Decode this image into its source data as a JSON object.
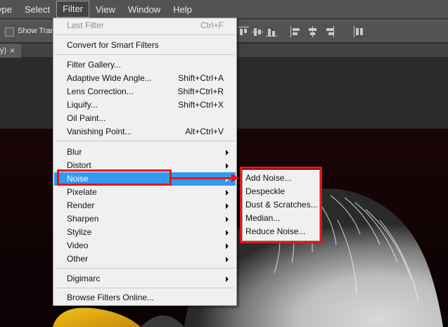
{
  "menubar": {
    "items": [
      {
        "label": "ype"
      },
      {
        "label": "Select"
      },
      {
        "label": "Filter"
      },
      {
        "label": "View"
      },
      {
        "label": "Window"
      },
      {
        "label": "Help"
      }
    ]
  },
  "options": {
    "show_label": "Show Trans",
    "icons": [
      "align-top-edges-icon",
      "align-vertical-centers-icon",
      "align-bottom-edges-icon",
      "align-left-edges-icon",
      "align-horizontal-centers-icon",
      "align-right-edges-icon",
      "distribute-icon"
    ]
  },
  "document_tab": {
    "label": "y)",
    "close": "×"
  },
  "filter_menu": {
    "last_filter": {
      "label": "Last Filter",
      "shortcut": "Ctrl+F"
    },
    "convert": {
      "label": "Convert for Smart Filters"
    },
    "filter_gallery": {
      "label": "Filter Gallery..."
    },
    "adaptive": {
      "label": "Adaptive Wide Angle...",
      "shortcut": "Shift+Ctrl+A"
    },
    "lens": {
      "label": "Lens Correction...",
      "shortcut": "Shift+Ctrl+R"
    },
    "liquify": {
      "label": "Liquify...",
      "shortcut": "Shift+Ctrl+X"
    },
    "oil": {
      "label": "Oil Paint..."
    },
    "vanishing": {
      "label": "Vanishing Point...",
      "shortcut": "Alt+Ctrl+V"
    },
    "blur": {
      "label": "Blur"
    },
    "distort": {
      "label": "Distort"
    },
    "noise": {
      "label": "Noise"
    },
    "pixelate": {
      "label": "Pixelate"
    },
    "render": {
      "label": "Render"
    },
    "sharpen": {
      "label": "Sharpen"
    },
    "stylize": {
      "label": "Stylize"
    },
    "video": {
      "label": "Video"
    },
    "other": {
      "label": "Other"
    },
    "digimarc": {
      "label": "Digimarc"
    },
    "browse": {
      "label": "Browse Filters Online..."
    }
  },
  "noise_submenu": {
    "items": [
      {
        "label": "Add Noise..."
      },
      {
        "label": "Despeckle"
      },
      {
        "label": "Dust & Scratches..."
      },
      {
        "label": "Median..."
      },
      {
        "label": "Reduce Noise..."
      }
    ]
  },
  "colors": {
    "highlight": "#3399f0",
    "annotation_red": "#e5141b",
    "menu_bg": "#f0f0f0",
    "chrome": "#535353"
  }
}
